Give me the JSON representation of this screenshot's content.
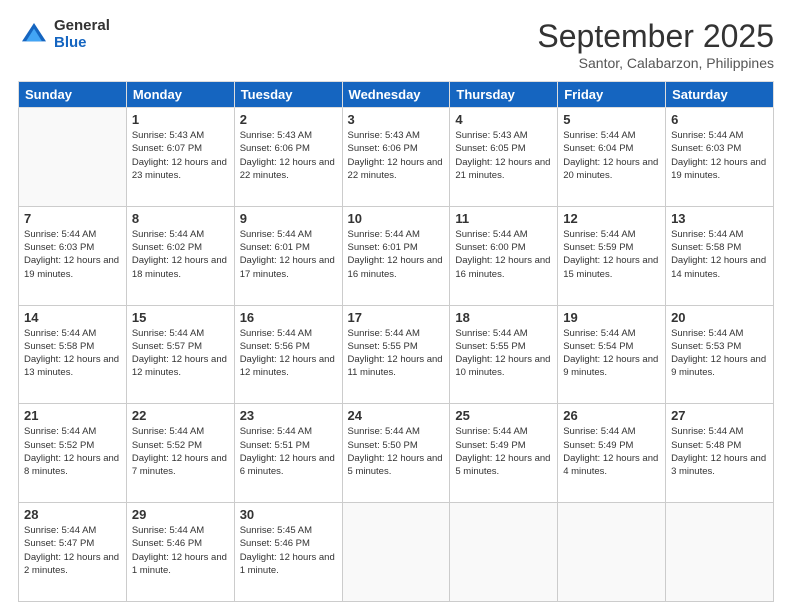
{
  "logo": {
    "general": "General",
    "blue": "Blue"
  },
  "header": {
    "month": "September 2025",
    "location": "Santor, Calabarzon, Philippines"
  },
  "days_of_week": [
    "Sunday",
    "Monday",
    "Tuesday",
    "Wednesday",
    "Thursday",
    "Friday",
    "Saturday"
  ],
  "weeks": [
    [
      {
        "day": "",
        "sunrise": "",
        "sunset": "",
        "daylight": ""
      },
      {
        "day": "1",
        "sunrise": "Sunrise: 5:43 AM",
        "sunset": "Sunset: 6:07 PM",
        "daylight": "Daylight: 12 hours and 23 minutes."
      },
      {
        "day": "2",
        "sunrise": "Sunrise: 5:43 AM",
        "sunset": "Sunset: 6:06 PM",
        "daylight": "Daylight: 12 hours and 22 minutes."
      },
      {
        "day": "3",
        "sunrise": "Sunrise: 5:43 AM",
        "sunset": "Sunset: 6:06 PM",
        "daylight": "Daylight: 12 hours and 22 minutes."
      },
      {
        "day": "4",
        "sunrise": "Sunrise: 5:43 AM",
        "sunset": "Sunset: 6:05 PM",
        "daylight": "Daylight: 12 hours and 21 minutes."
      },
      {
        "day": "5",
        "sunrise": "Sunrise: 5:44 AM",
        "sunset": "Sunset: 6:04 PM",
        "daylight": "Daylight: 12 hours and 20 minutes."
      },
      {
        "day": "6",
        "sunrise": "Sunrise: 5:44 AM",
        "sunset": "Sunset: 6:03 PM",
        "daylight": "Daylight: 12 hours and 19 minutes."
      }
    ],
    [
      {
        "day": "7",
        "sunrise": "Sunrise: 5:44 AM",
        "sunset": "Sunset: 6:03 PM",
        "daylight": "Daylight: 12 hours and 19 minutes."
      },
      {
        "day": "8",
        "sunrise": "Sunrise: 5:44 AM",
        "sunset": "Sunset: 6:02 PM",
        "daylight": "Daylight: 12 hours and 18 minutes."
      },
      {
        "day": "9",
        "sunrise": "Sunrise: 5:44 AM",
        "sunset": "Sunset: 6:01 PM",
        "daylight": "Daylight: 12 hours and 17 minutes."
      },
      {
        "day": "10",
        "sunrise": "Sunrise: 5:44 AM",
        "sunset": "Sunset: 6:01 PM",
        "daylight": "Daylight: 12 hours and 16 minutes."
      },
      {
        "day": "11",
        "sunrise": "Sunrise: 5:44 AM",
        "sunset": "Sunset: 6:00 PM",
        "daylight": "Daylight: 12 hours and 16 minutes."
      },
      {
        "day": "12",
        "sunrise": "Sunrise: 5:44 AM",
        "sunset": "Sunset: 5:59 PM",
        "daylight": "Daylight: 12 hours and 15 minutes."
      },
      {
        "day": "13",
        "sunrise": "Sunrise: 5:44 AM",
        "sunset": "Sunset: 5:58 PM",
        "daylight": "Daylight: 12 hours and 14 minutes."
      }
    ],
    [
      {
        "day": "14",
        "sunrise": "Sunrise: 5:44 AM",
        "sunset": "Sunset: 5:58 PM",
        "daylight": "Daylight: 12 hours and 13 minutes."
      },
      {
        "day": "15",
        "sunrise": "Sunrise: 5:44 AM",
        "sunset": "Sunset: 5:57 PM",
        "daylight": "Daylight: 12 hours and 12 minutes."
      },
      {
        "day": "16",
        "sunrise": "Sunrise: 5:44 AM",
        "sunset": "Sunset: 5:56 PM",
        "daylight": "Daylight: 12 hours and 12 minutes."
      },
      {
        "day": "17",
        "sunrise": "Sunrise: 5:44 AM",
        "sunset": "Sunset: 5:55 PM",
        "daylight": "Daylight: 12 hours and 11 minutes."
      },
      {
        "day": "18",
        "sunrise": "Sunrise: 5:44 AM",
        "sunset": "Sunset: 5:55 PM",
        "daylight": "Daylight: 12 hours and 10 minutes."
      },
      {
        "day": "19",
        "sunrise": "Sunrise: 5:44 AM",
        "sunset": "Sunset: 5:54 PM",
        "daylight": "Daylight: 12 hours and 9 minutes."
      },
      {
        "day": "20",
        "sunrise": "Sunrise: 5:44 AM",
        "sunset": "Sunset: 5:53 PM",
        "daylight": "Daylight: 12 hours and 9 minutes."
      }
    ],
    [
      {
        "day": "21",
        "sunrise": "Sunrise: 5:44 AM",
        "sunset": "Sunset: 5:52 PM",
        "daylight": "Daylight: 12 hours and 8 minutes."
      },
      {
        "day": "22",
        "sunrise": "Sunrise: 5:44 AM",
        "sunset": "Sunset: 5:52 PM",
        "daylight": "Daylight: 12 hours and 7 minutes."
      },
      {
        "day": "23",
        "sunrise": "Sunrise: 5:44 AM",
        "sunset": "Sunset: 5:51 PM",
        "daylight": "Daylight: 12 hours and 6 minutes."
      },
      {
        "day": "24",
        "sunrise": "Sunrise: 5:44 AM",
        "sunset": "Sunset: 5:50 PM",
        "daylight": "Daylight: 12 hours and 5 minutes."
      },
      {
        "day": "25",
        "sunrise": "Sunrise: 5:44 AM",
        "sunset": "Sunset: 5:49 PM",
        "daylight": "Daylight: 12 hours and 5 minutes."
      },
      {
        "day": "26",
        "sunrise": "Sunrise: 5:44 AM",
        "sunset": "Sunset: 5:49 PM",
        "daylight": "Daylight: 12 hours and 4 minutes."
      },
      {
        "day": "27",
        "sunrise": "Sunrise: 5:44 AM",
        "sunset": "Sunset: 5:48 PM",
        "daylight": "Daylight: 12 hours and 3 minutes."
      }
    ],
    [
      {
        "day": "28",
        "sunrise": "Sunrise: 5:44 AM",
        "sunset": "Sunset: 5:47 PM",
        "daylight": "Daylight: 12 hours and 2 minutes."
      },
      {
        "day": "29",
        "sunrise": "Sunrise: 5:44 AM",
        "sunset": "Sunset: 5:46 PM",
        "daylight": "Daylight: 12 hours and 1 minute."
      },
      {
        "day": "30",
        "sunrise": "Sunrise: 5:45 AM",
        "sunset": "Sunset: 5:46 PM",
        "daylight": "Daylight: 12 hours and 1 minute."
      },
      {
        "day": "",
        "sunrise": "",
        "sunset": "",
        "daylight": ""
      },
      {
        "day": "",
        "sunrise": "",
        "sunset": "",
        "daylight": ""
      },
      {
        "day": "",
        "sunrise": "",
        "sunset": "",
        "daylight": ""
      },
      {
        "day": "",
        "sunrise": "",
        "sunset": "",
        "daylight": ""
      }
    ]
  ]
}
